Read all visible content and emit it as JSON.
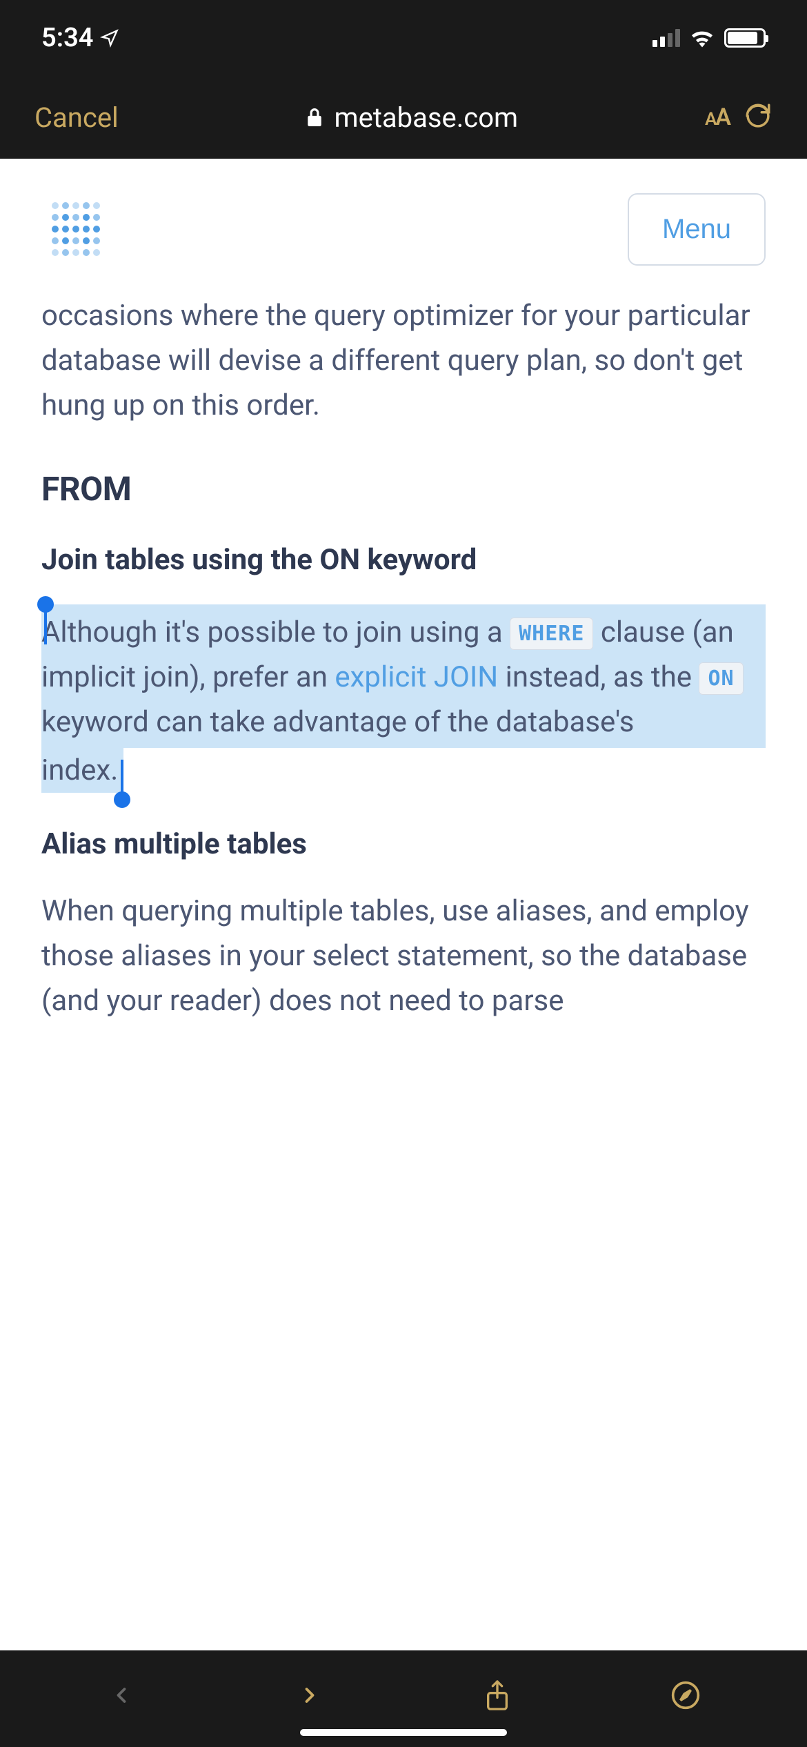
{
  "status": {
    "time": "5:34"
  },
  "browser": {
    "cancel": "Cancel",
    "domain": "metabase.com",
    "aa_small": "A",
    "aa_large": "A"
  },
  "site": {
    "menu": "Menu"
  },
  "article": {
    "p1": "occasions where the query optimizer for your particular database will devise a different query plan, so don't get hung up on this order.",
    "h2_from": "FROM",
    "h3_join": "Join tables using the ON keyword",
    "sel_part1": "Although it's possible to join using a ",
    "code_where": "WHERE",
    "sel_part2": " clause (an implicit join), prefer an ",
    "link_join": "explicit JOIN",
    "sel_part3": " instead, as the ",
    "code_on": "ON",
    "sel_part4": " keyword can take advantage of the database's",
    "sel_lastword": "index.",
    "h3_alias": "Alias multiple tables",
    "p2": "When querying multiple tables, use aliases, and employ those aliases in your select statement, so the database (and your reader) does not need to parse"
  }
}
